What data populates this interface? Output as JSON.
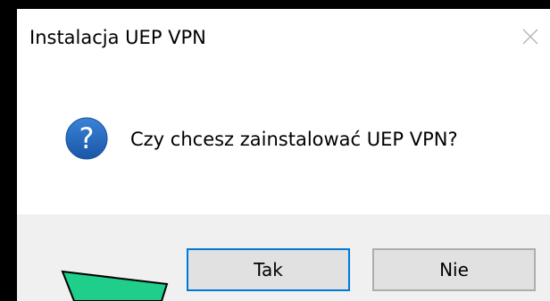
{
  "window": {
    "title": "Instalacja UEP VPN"
  },
  "icons": {
    "close": "close-icon",
    "question": "question-icon"
  },
  "message": "Czy chcesz zainstalować UEP VPN?",
  "buttons": {
    "yes_label": "Tak",
    "no_label": "Nie"
  },
  "colors": {
    "question_icon_fill": "#1e63b5",
    "default_button_border": "#0078d7",
    "annotation_arrow": "#1fce8a"
  }
}
